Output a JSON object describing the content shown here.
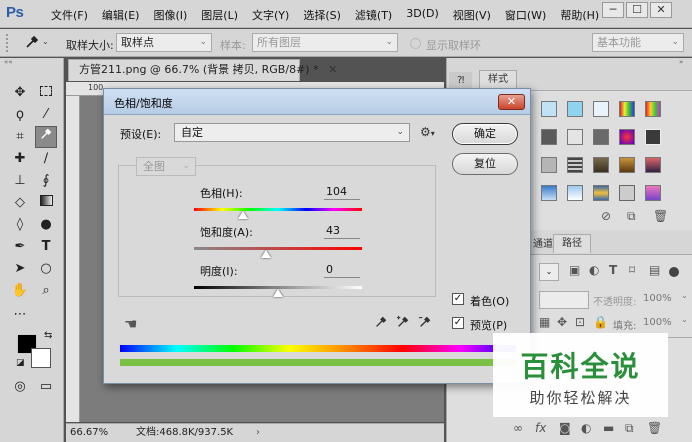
{
  "menubar": {
    "logo": "Ps",
    "items": [
      "文件(F)",
      "编辑(E)",
      "图像(I)",
      "图层(L)",
      "文字(Y)",
      "选择(S)",
      "滤镜(T)",
      "3D(D)",
      "视图(V)",
      "窗口(W)",
      "帮助(H)"
    ],
    "window_buttons": [
      "─",
      "☐",
      "✕"
    ]
  },
  "options": {
    "sample_size_label": "取样大小:",
    "sample_size_value": "取样点",
    "sample_label": "样本:",
    "sample_value": "所有图层",
    "show_ring_label": "显示取样环",
    "workspace_value": "基本功能"
  },
  "document": {
    "tab_title": "方管211.png @ 66.7% (背景 拷贝, RGB/8#) *",
    "tab_close": "✕",
    "ruler_mark": "100",
    "zoom": "66.67%",
    "doc_size": "文档:468.8K/937.5K"
  },
  "right_panel": {
    "tab_label_1": "样式",
    "tab_paths": "路径",
    "tab_channels": "通道",
    "opacity_label": "不透明度:",
    "opacity_value": "100%",
    "fill_label": "填充:",
    "fill_value": "100%"
  },
  "dialog": {
    "title": "色相/饱和度",
    "close": "✕",
    "preset_label": "预设(E):",
    "preset_value": "自定",
    "channel_value": "全图",
    "ok_label": "确定",
    "reset_label": "复位",
    "hue_label": "色相(H):",
    "hue_value": "104",
    "saturation_label": "饱和度(A):",
    "saturation_value": "43",
    "lightness_label": "明度(I):",
    "lightness_value": "0",
    "colorize_label": "着色(O)",
    "preview_label": "预览(P)",
    "colorize_checked": true,
    "preview_checked": true,
    "hue_slider_fraction": 0.29,
    "saturation_slider_fraction": 0.43,
    "lightness_slider_fraction": 0.5
  },
  "watermark": {
    "title": "百科全说",
    "subtitle": "助你轻松解决"
  }
}
